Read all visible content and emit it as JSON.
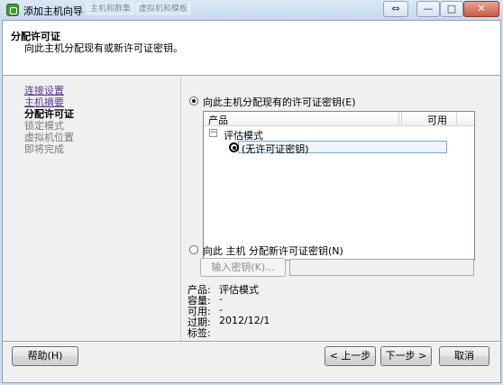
{
  "window": {
    "title": "添加主机向导",
    "ghost_tabs": [
      "主机和群集",
      "虚拟机和模板"
    ],
    "controls": {
      "restore": "⇔",
      "minimize": "—",
      "maximize": "□",
      "close": "✕"
    }
  },
  "header": {
    "title": "分配许可证",
    "subtitle": "向此主机分配现有或新许可证密钥。"
  },
  "nav": {
    "items": [
      {
        "label": "连接设置",
        "state": "link"
      },
      {
        "label": "主机摘要",
        "state": "link"
      },
      {
        "label": "分配许可证",
        "state": "current"
      },
      {
        "label": "锁定模式",
        "state": "disabled"
      },
      {
        "label": "虚拟机位置",
        "state": "disabled"
      },
      {
        "label": "即将完成",
        "state": "disabled"
      }
    ]
  },
  "license": {
    "existing_option": {
      "label": "向此主机分配现有的许可证密钥(E)",
      "checked": true
    },
    "grid": {
      "columns": [
        "产品",
        "可用"
      ],
      "group": {
        "toggle": "⊟",
        "label": "评估模式"
      },
      "selected_row": "(无许可证密钥)"
    },
    "new_option": {
      "label": "向此 主机 分配新许可证密钥(N)",
      "checked": false
    },
    "enter_key_button": "输入密钥(K)...",
    "key_value": ""
  },
  "details": {
    "rows": [
      {
        "label": "产品:",
        "value": "评估模式"
      },
      {
        "label": "容量:",
        "value": "-"
      },
      {
        "label": "可用:",
        "value": "-"
      },
      {
        "label": "过期:",
        "value": "2012/12/1"
      },
      {
        "label": "标签:",
        "value": ""
      }
    ]
  },
  "footer": {
    "help": "帮助(H)",
    "back": "< 上一步",
    "next": "下一步 >",
    "cancel": "取消"
  }
}
